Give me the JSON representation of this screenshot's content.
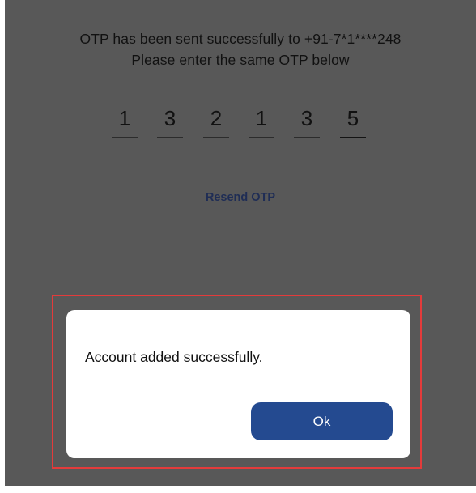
{
  "otp_screen": {
    "sent_message": "OTP has been sent successfully to +91-7*1****248",
    "instruction": "Please enter the same OTP below",
    "digits": [
      "1",
      "3",
      "2",
      "1",
      "3",
      "5"
    ],
    "resend_label": "Resend OTP"
  },
  "dialog": {
    "message": "Account added successfully.",
    "ok_label": "Ok"
  },
  "colors": {
    "overlay": "#585858",
    "button": "#244a90",
    "resend_link": "#1f2d55",
    "highlight": "#e33b3b"
  }
}
